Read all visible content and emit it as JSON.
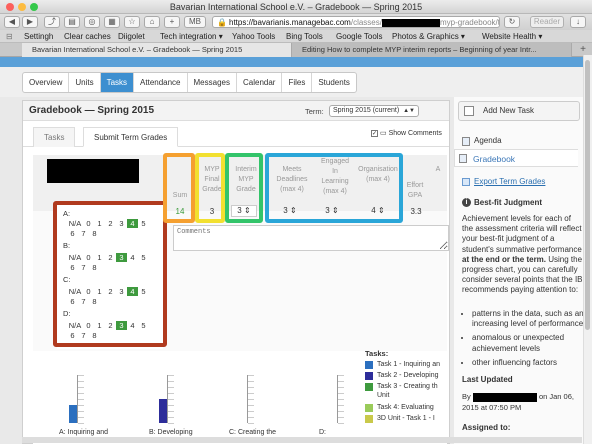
{
  "browser": {
    "window_title": "Bavarian International School e.V. – Gradebook — Spring 2015",
    "address": {
      "secure_icon": "lock-icon",
      "badge": "MB",
      "host": "https://bavarianis.managebac.com",
      "path_visible": "/classes/",
      "path_tail": "myp-gradebook/tasks/tern"
    },
    "reader_label": "Reader",
    "bookmarks": [
      "Settingh",
      "Clear caches",
      "Diigolet",
      "Tech integration ▾",
      "Yahoo Tools",
      "Bing Tools",
      "Google Tools",
      "Photos & Graphics ▾",
      "Website Health ▾"
    ],
    "tabs": [
      {
        "label": "Bavarian International School e.V. – Gradebook — Spring 2015",
        "active": true
      },
      {
        "label": "Editing How to complete MYP interim reports – Beginning of year Intr...",
        "active": false
      }
    ]
  },
  "nav": {
    "tabs": [
      "Overview",
      "Units",
      "Tasks",
      "Attendance",
      "Messages",
      "Calendar",
      "Files",
      "Students"
    ],
    "active": "Tasks"
  },
  "gradebook": {
    "title": "Gradebook — Spring 2015",
    "term_label": "Term:",
    "term_value": "Spring 2015 (current)",
    "subtabs": [
      "Tasks",
      "Submit Term Grades"
    ],
    "show_comments_label": "Show Comments",
    "columns": {
      "sum": "Sum",
      "myp_final": [
        "MYP",
        "Final",
        "Grade"
      ],
      "interim": [
        "Interim",
        "MYP",
        "Grade"
      ],
      "meets": [
        "Meets",
        "Deadlines",
        "(max 4)"
      ],
      "engaged": [
        "Engaged",
        "In",
        "Learning",
        "(max 4)"
      ],
      "organisation": [
        "Organisation",
        "(max 4)"
      ],
      "effort": [
        "Effort",
        "GPA"
      ],
      "cut": [
        "A"
      ]
    },
    "row": {
      "sum": "14",
      "myp_final": "3",
      "interim": "3",
      "meets": "3",
      "engaged": "3",
      "organisation": "4",
      "effort": "3.3"
    },
    "criteria": [
      {
        "label": "A:",
        "levels": [
          "N/A",
          "0",
          "1",
          "2",
          "3",
          "4",
          "5",
          "6",
          "7",
          "8"
        ],
        "selected": "4"
      },
      {
        "label": "B:",
        "levels": [
          "N/A",
          "0",
          "1",
          "2",
          "3",
          "4",
          "5",
          "6",
          "7",
          "8"
        ],
        "selected": "3"
      },
      {
        "label": "C:",
        "levels": [
          "N/A",
          "0",
          "1",
          "2",
          "3",
          "4",
          "5",
          "6",
          "7",
          "8"
        ],
        "selected": "4"
      },
      {
        "label": "D:",
        "levels": [
          "N/A",
          "0",
          "1",
          "2",
          "3",
          "4",
          "5",
          "6",
          "7",
          "8"
        ],
        "selected": "3"
      }
    ],
    "comments_placeholder": "Comments",
    "highlight_colors": {
      "criteria": "#b03a1e",
      "sum": "#f5a030",
      "myp_final": "#f2e030",
      "interim": "#33c46a",
      "atl": "#2aa6d8"
    }
  },
  "chart_data": {
    "type": "bar",
    "categories": [
      "A: Inquiring and",
      "B: Developing",
      "C: Creating the",
      "D:"
    ],
    "values": [
      3,
      4,
      null,
      null
    ],
    "ylim": [
      0,
      8
    ],
    "colors": [
      "#2b6fbf",
      "#2d2d9a",
      "#3e9a3e",
      "#9acb5a"
    ],
    "legend_title": "Tasks:",
    "legend": [
      {
        "label": "Task 1 - Inquiring an",
        "color": "#2b6fbf"
      },
      {
        "label": "Task 2 - Developing",
        "color": "#2d2d9a"
      },
      {
        "label": "Task 3 - Creating th Unit",
        "color": "#3e9a3e"
      },
      {
        "label": "Task 4: Evaluating",
        "color": "#9acb5a"
      },
      {
        "label": "3D Unit - Task 1 - I",
        "color": "#c9c94a"
      }
    ]
  },
  "sidebar": {
    "add_task": "Add New Task",
    "agenda": "Agenda",
    "gradebook": "Gradebook",
    "export": "Export Term Grades",
    "best_fit_title": "Best-fit Judgment",
    "best_fit_text_1": "Achievement levels for each of the assessment criteria will reflect your best-fit judgment of a student's summative performance",
    "best_fit_bold": "at the end or the term.",
    "best_fit_text_2": "Using the progress chart, you can carefully consider several points that the IB recommends paying attention to:",
    "bullets": [
      "patterns in the data, such as an increasing level of performance",
      "anomalous or unexpected achievement levels",
      "other influencing factors"
    ],
    "last_updated_title": "Last Updated",
    "by_label": "By",
    "updated_on": "on Jan 06, 2015 at 07:50 PM",
    "assigned_to": "Assigned to:"
  }
}
